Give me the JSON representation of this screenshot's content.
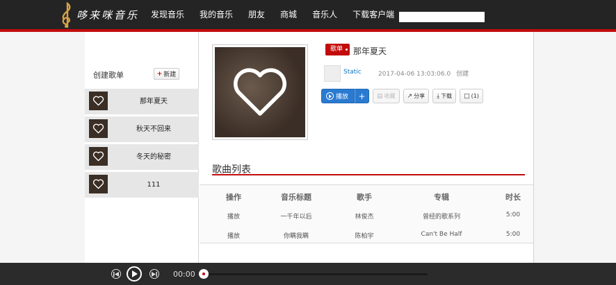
{
  "brand": {
    "name": "哆来咪音乐",
    "accent": "#c20c0c",
    "link": "#0c73c2"
  },
  "nav": {
    "items": [
      {
        "label": "发现音乐"
      },
      {
        "label": "我的音乐"
      },
      {
        "label": "朋友"
      },
      {
        "label": "商城"
      },
      {
        "label": "音乐人"
      },
      {
        "label": "下载客户端"
      }
    ],
    "search_value": ""
  },
  "sidebar": {
    "heading": "创建歌单",
    "new_button": "新建",
    "playlists": [
      {
        "name": "那年夏天",
        "icon": "heart-icon"
      },
      {
        "name": "秋天不回来",
        "icon": "heart-icon"
      },
      {
        "name": "冬天的秘密",
        "icon": "heart-icon"
      },
      {
        "name": "111",
        "icon": "heart-icon"
      }
    ]
  },
  "playlist": {
    "tag": "歌单",
    "title": "那年夏天",
    "user": "Static",
    "created_at": "2017-04-06 13:03:06.0",
    "created_label": "创建",
    "actions": {
      "play": "播放",
      "add": "+",
      "collect": "收藏",
      "share": "分享",
      "download": "下载",
      "comment": "(1)"
    }
  },
  "songs": {
    "title": "歌曲列表",
    "columns": [
      "操作",
      "音乐标题",
      "歌手",
      "专辑",
      "时长"
    ],
    "rows": [
      {
        "action": "播放",
        "title": "一千年以后",
        "artist": "林俊杰",
        "album": "曾经的歌系列",
        "duration": "5:00"
      },
      {
        "action": "播放",
        "title": "你瞒我瞒",
        "artist": "陈柏宇",
        "album": "Can't Be Half",
        "duration": "5:00"
      }
    ]
  },
  "player": {
    "time": "00:00",
    "progress": 0
  }
}
